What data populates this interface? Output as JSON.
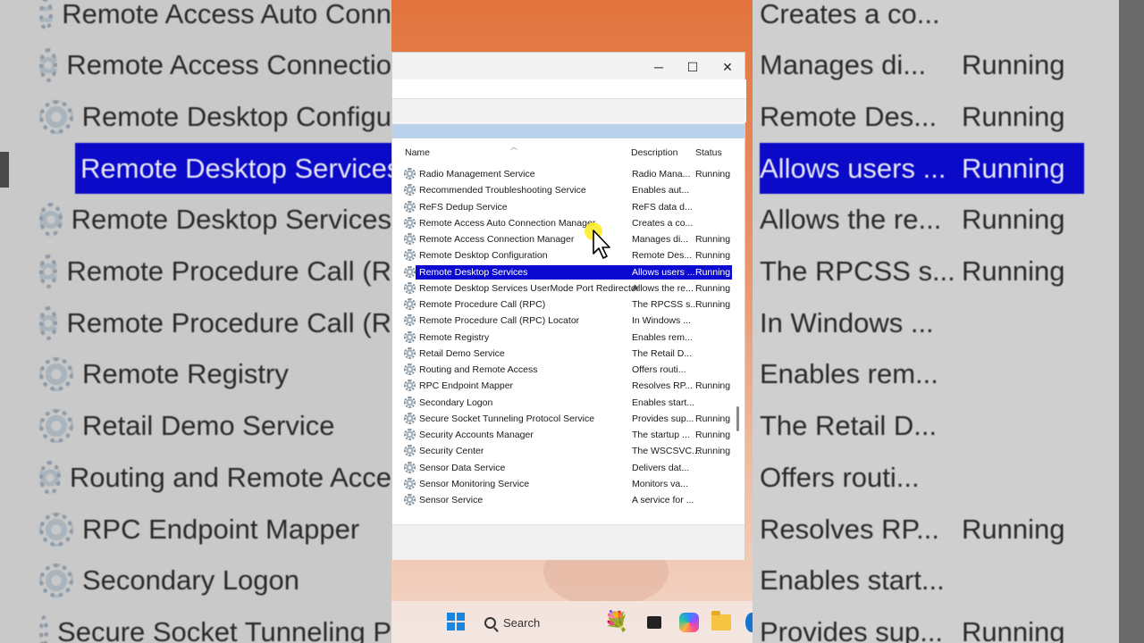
{
  "window": {
    "controls": {
      "minimize": "─",
      "maximize": "☐",
      "close": "✕"
    }
  },
  "columns": {
    "name": "Name",
    "description": "Description",
    "status": "Status"
  },
  "services": [
    {
      "name": "Radio Management Service",
      "description": "Radio Mana...",
      "status": "Running"
    },
    {
      "name": "Recommended Troubleshooting Service",
      "description": "Enables aut...",
      "status": ""
    },
    {
      "name": "ReFS Dedup Service",
      "description": "ReFS data d...",
      "status": ""
    },
    {
      "name": "Remote Access Auto Connection Manager",
      "description": "Creates a co...",
      "status": ""
    },
    {
      "name": "Remote Access Connection Manager",
      "description": "Manages di...",
      "status": "Running"
    },
    {
      "name": "Remote Desktop Configuration",
      "description": "Remote Des...",
      "status": "Running"
    },
    {
      "name": "Remote Desktop Services",
      "description": "Allows users ...",
      "status": "Running",
      "selected": true
    },
    {
      "name": "Remote Desktop Services UserMode Port Redirector",
      "description": "Allows the re...",
      "status": "Running"
    },
    {
      "name": "Remote Procedure Call (RPC)",
      "description": "The RPCSS s...",
      "status": "Running"
    },
    {
      "name": "Remote Procedure Call (RPC) Locator",
      "description": "In Windows ...",
      "status": ""
    },
    {
      "name": "Remote Registry",
      "description": "Enables rem...",
      "status": ""
    },
    {
      "name": "Retail Demo Service",
      "description": "The Retail D...",
      "status": ""
    },
    {
      "name": "Routing and Remote Access",
      "description": "Offers routi...",
      "status": ""
    },
    {
      "name": "RPC Endpoint Mapper",
      "description": "Resolves RP...",
      "status": "Running"
    },
    {
      "name": "Secondary Logon",
      "description": "Enables start...",
      "status": ""
    },
    {
      "name": "Secure Socket Tunneling Protocol Service",
      "description": "Provides sup...",
      "status": "Running"
    },
    {
      "name": "Security Accounts Manager",
      "description": "The startup ...",
      "status": "Running"
    },
    {
      "name": "Security Center",
      "description": "The WSCSVC...",
      "status": "Running"
    },
    {
      "name": "Sensor Data Service",
      "description": "Delivers dat...",
      "status": ""
    },
    {
      "name": "Sensor Monitoring Service",
      "description": "Monitors va...",
      "status": ""
    },
    {
      "name": "Sensor Service",
      "description": "A service for ...",
      "status": ""
    }
  ],
  "background_left": [
    {
      "text": "Remote Access Auto Conn",
      "selected": false
    },
    {
      "text": "Remote Access Connectio",
      "selected": false
    },
    {
      "text": "Remote Desktop Configu",
      "selected": false
    },
    {
      "text": "Remote Desktop Services",
      "selected": true
    },
    {
      "text": "Remote Desktop Services",
      "selected": false
    },
    {
      "text": "Remote Procedure Call (R",
      "selected": false
    },
    {
      "text": "Remote Procedure Call (R",
      "selected": false
    },
    {
      "text": "Remote Registry",
      "selected": false
    },
    {
      "text": "Retail Demo Service",
      "selected": false
    },
    {
      "text": "Routing and Remote Acce",
      "selected": false
    },
    {
      "text": "RPC Endpoint Mapper",
      "selected": false
    },
    {
      "text": "Secondary Logon",
      "selected": false
    },
    {
      "text": "Secure Socket Tunneling P",
      "selected": false
    }
  ],
  "background_right": [
    {
      "description": "Creates a co...",
      "status": "",
      "selected": false
    },
    {
      "description": "Manages di...",
      "status": "Running",
      "selected": false
    },
    {
      "description": "Remote Des...",
      "status": "Running",
      "selected": false
    },
    {
      "description": "Allows users ...",
      "status": "Running",
      "selected": true
    },
    {
      "description": "Allows the re...",
      "status": "Running",
      "selected": false
    },
    {
      "description": "The RPCSS s...",
      "status": "Running",
      "selected": false
    },
    {
      "description": "In Windows ...",
      "status": "",
      "selected": false
    },
    {
      "description": "Enables rem...",
      "status": "",
      "selected": false
    },
    {
      "description": "The Retail D...",
      "status": "",
      "selected": false
    },
    {
      "description": "Offers routi...",
      "status": "",
      "selected": false
    },
    {
      "description": "Resolves RP...",
      "status": "Running",
      "selected": false
    },
    {
      "description": "Enables start...",
      "status": "",
      "selected": false
    },
    {
      "description": "Provides sup...",
      "status": "Running",
      "selected": false
    }
  ],
  "taskbar": {
    "search_label": "Search",
    "icons": [
      "windows-start-icon",
      "search-icon",
      "flowers-widget-icon",
      "app-icon",
      "copilot-icon",
      "file-explorer-icon",
      "edge-icon"
    ],
    "flowers_glyph": "💐"
  },
  "colors": {
    "selection": "#0a0ad0",
    "wallpaper": "#e2733d",
    "pane_header": "#b9d1ea",
    "cursor_halo": "#ffeb1e"
  }
}
